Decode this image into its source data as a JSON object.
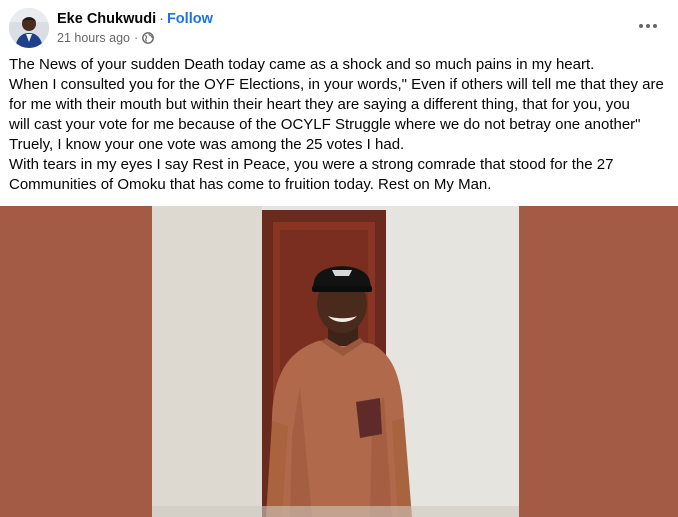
{
  "post": {
    "author": "Eke Chukwudi",
    "separator": "·",
    "follow_label": "Follow",
    "timestamp": "21 hours ago",
    "meta_separator": "·",
    "privacy_icon": "globe-icon",
    "more_icon": "more-horizontal-icon",
    "body_lines": [
      "The News of your sudden Death today came as a shock and so much pains in my heart.",
      "When I consulted you for the OYF Elections, in your words,\" Even if others will tell me that they are",
      "for me with their mouth but within their heart they are saying a different thing, that for you, you",
      "will cast your vote for me because of the OCYLF Struggle where we do not betray one another\"",
      "Truely, I know your one vote was among the 25 votes I had.",
      "With tears in my eyes I say Rest in Peace, you were a strong comrade that stood for the 27",
      "Communities of Omoku that has come to fruition today. Rest on My Man."
    ],
    "image_description_icon": "photo-of-man-in-cap-and-native-attire",
    "colors": {
      "follow": "#1b74e4",
      "image_border": "#a35b45",
      "meta_text": "#65676b"
    }
  }
}
